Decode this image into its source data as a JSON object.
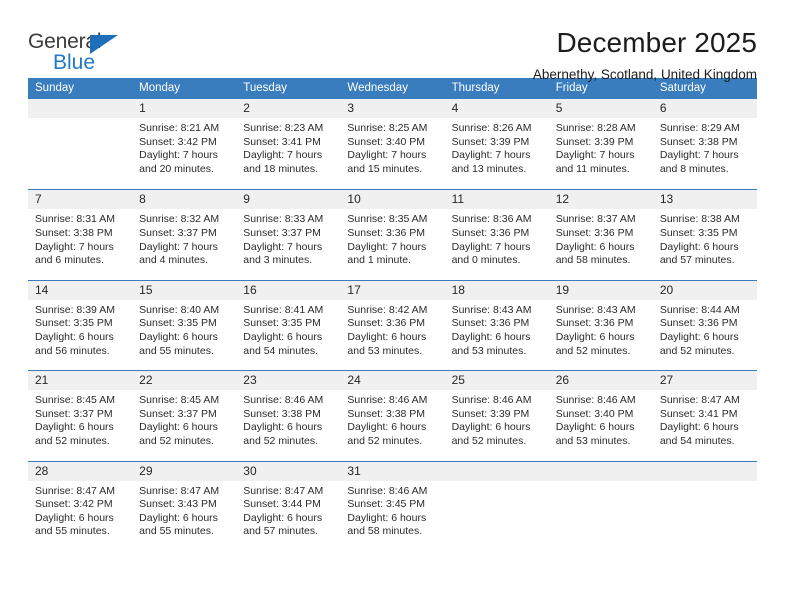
{
  "brand": {
    "name_top": "General",
    "name_bottom": "Blue",
    "triangle_color": "#1c6fb8"
  },
  "header": {
    "title": "December 2025",
    "subtitle": "Abernethy, Scotland, United Kingdom"
  },
  "theme": {
    "header_blue": "#3a7dbf",
    "day_band_gray": "#f0f0f0",
    "text": "#2b2b2b"
  },
  "weekday_headers": [
    "Sunday",
    "Monday",
    "Tuesday",
    "Wednesday",
    "Thursday",
    "Friday",
    "Saturday"
  ],
  "weeks": [
    [
      {
        "day": "",
        "lines": []
      },
      {
        "day": "1",
        "lines": [
          "Sunrise: 8:21 AM",
          "Sunset: 3:42 PM",
          "Daylight: 7 hours",
          "and 20 minutes."
        ]
      },
      {
        "day": "2",
        "lines": [
          "Sunrise: 8:23 AM",
          "Sunset: 3:41 PM",
          "Daylight: 7 hours",
          "and 18 minutes."
        ]
      },
      {
        "day": "3",
        "lines": [
          "Sunrise: 8:25 AM",
          "Sunset: 3:40 PM",
          "Daylight: 7 hours",
          "and 15 minutes."
        ]
      },
      {
        "day": "4",
        "lines": [
          "Sunrise: 8:26 AM",
          "Sunset: 3:39 PM",
          "Daylight: 7 hours",
          "and 13 minutes."
        ]
      },
      {
        "day": "5",
        "lines": [
          "Sunrise: 8:28 AM",
          "Sunset: 3:39 PM",
          "Daylight: 7 hours",
          "and 11 minutes."
        ]
      },
      {
        "day": "6",
        "lines": [
          "Sunrise: 8:29 AM",
          "Sunset: 3:38 PM",
          "Daylight: 7 hours",
          "and 8 minutes."
        ]
      }
    ],
    [
      {
        "day": "7",
        "lines": [
          "Sunrise: 8:31 AM",
          "Sunset: 3:38 PM",
          "Daylight: 7 hours",
          "and 6 minutes."
        ]
      },
      {
        "day": "8",
        "lines": [
          "Sunrise: 8:32 AM",
          "Sunset: 3:37 PM",
          "Daylight: 7 hours",
          "and 4 minutes."
        ]
      },
      {
        "day": "9",
        "lines": [
          "Sunrise: 8:33 AM",
          "Sunset: 3:37 PM",
          "Daylight: 7 hours",
          "and 3 minutes."
        ]
      },
      {
        "day": "10",
        "lines": [
          "Sunrise: 8:35 AM",
          "Sunset: 3:36 PM",
          "Daylight: 7 hours",
          "and 1 minute."
        ]
      },
      {
        "day": "11",
        "lines": [
          "Sunrise: 8:36 AM",
          "Sunset: 3:36 PM",
          "Daylight: 7 hours",
          "and 0 minutes."
        ]
      },
      {
        "day": "12",
        "lines": [
          "Sunrise: 8:37 AM",
          "Sunset: 3:36 PM",
          "Daylight: 6 hours",
          "and 58 minutes."
        ]
      },
      {
        "day": "13",
        "lines": [
          "Sunrise: 8:38 AM",
          "Sunset: 3:35 PM",
          "Daylight: 6 hours",
          "and 57 minutes."
        ]
      }
    ],
    [
      {
        "day": "14",
        "lines": [
          "Sunrise: 8:39 AM",
          "Sunset: 3:35 PM",
          "Daylight: 6 hours",
          "and 56 minutes."
        ]
      },
      {
        "day": "15",
        "lines": [
          "Sunrise: 8:40 AM",
          "Sunset: 3:35 PM",
          "Daylight: 6 hours",
          "and 55 minutes."
        ]
      },
      {
        "day": "16",
        "lines": [
          "Sunrise: 8:41 AM",
          "Sunset: 3:35 PM",
          "Daylight: 6 hours",
          "and 54 minutes."
        ]
      },
      {
        "day": "17",
        "lines": [
          "Sunrise: 8:42 AM",
          "Sunset: 3:36 PM",
          "Daylight: 6 hours",
          "and 53 minutes."
        ]
      },
      {
        "day": "18",
        "lines": [
          "Sunrise: 8:43 AM",
          "Sunset: 3:36 PM",
          "Daylight: 6 hours",
          "and 53 minutes."
        ]
      },
      {
        "day": "19",
        "lines": [
          "Sunrise: 8:43 AM",
          "Sunset: 3:36 PM",
          "Daylight: 6 hours",
          "and 52 minutes."
        ]
      },
      {
        "day": "20",
        "lines": [
          "Sunrise: 8:44 AM",
          "Sunset: 3:36 PM",
          "Daylight: 6 hours",
          "and 52 minutes."
        ]
      }
    ],
    [
      {
        "day": "21",
        "lines": [
          "Sunrise: 8:45 AM",
          "Sunset: 3:37 PM",
          "Daylight: 6 hours",
          "and 52 minutes."
        ]
      },
      {
        "day": "22",
        "lines": [
          "Sunrise: 8:45 AM",
          "Sunset: 3:37 PM",
          "Daylight: 6 hours",
          "and 52 minutes."
        ]
      },
      {
        "day": "23",
        "lines": [
          "Sunrise: 8:46 AM",
          "Sunset: 3:38 PM",
          "Daylight: 6 hours",
          "and 52 minutes."
        ]
      },
      {
        "day": "24",
        "lines": [
          "Sunrise: 8:46 AM",
          "Sunset: 3:38 PM",
          "Daylight: 6 hours",
          "and 52 minutes."
        ]
      },
      {
        "day": "25",
        "lines": [
          "Sunrise: 8:46 AM",
          "Sunset: 3:39 PM",
          "Daylight: 6 hours",
          "and 52 minutes."
        ]
      },
      {
        "day": "26",
        "lines": [
          "Sunrise: 8:46 AM",
          "Sunset: 3:40 PM",
          "Daylight: 6 hours",
          "and 53 minutes."
        ]
      },
      {
        "day": "27",
        "lines": [
          "Sunrise: 8:47 AM",
          "Sunset: 3:41 PM",
          "Daylight: 6 hours",
          "and 54 minutes."
        ]
      }
    ],
    [
      {
        "day": "28",
        "lines": [
          "Sunrise: 8:47 AM",
          "Sunset: 3:42 PM",
          "Daylight: 6 hours",
          "and 55 minutes."
        ]
      },
      {
        "day": "29",
        "lines": [
          "Sunrise: 8:47 AM",
          "Sunset: 3:43 PM",
          "Daylight: 6 hours",
          "and 55 minutes."
        ]
      },
      {
        "day": "30",
        "lines": [
          "Sunrise: 8:47 AM",
          "Sunset: 3:44 PM",
          "Daylight: 6 hours",
          "and 57 minutes."
        ]
      },
      {
        "day": "31",
        "lines": [
          "Sunrise: 8:46 AM",
          "Sunset: 3:45 PM",
          "Daylight: 6 hours",
          "and 58 minutes."
        ]
      },
      {
        "day": "",
        "lines": []
      },
      {
        "day": "",
        "lines": []
      },
      {
        "day": "",
        "lines": []
      }
    ]
  ]
}
